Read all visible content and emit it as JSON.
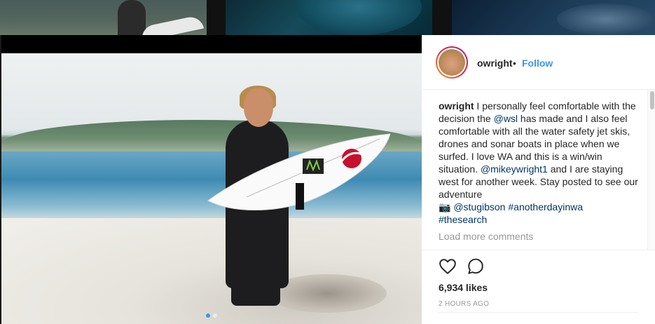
{
  "post": {
    "username": "owright",
    "separator": "•",
    "follow_label": "Follow",
    "caption": {
      "user": "owright",
      "text_1": " I personally feel comfortable with the decision the ",
      "mention_1": "@wsl",
      "text_2": " has made and I also feel comfortable with all the water safety jet skis, drones and sonar boats in place when we surfed. I love WA and this is a win/win situation. ",
      "mention_2": "@mikeywright1",
      "text_3": " and I are staying west for another week. Stay posted to see our adventure ",
      "camera_glyph": "📷",
      "mention_3": "@stugibson",
      "tag_1": "#anotherdayinwa",
      "tag_2": "#thesearch"
    },
    "load_more": "Load more comments",
    "likes": "6,934 likes",
    "time": "2 HOURS AGO"
  },
  "icons": {
    "like": "heart-icon",
    "comment": "comment-icon"
  },
  "colors": {
    "link": "#3897f0",
    "mention": "#003569",
    "avatar_ring": "#dc2743"
  }
}
